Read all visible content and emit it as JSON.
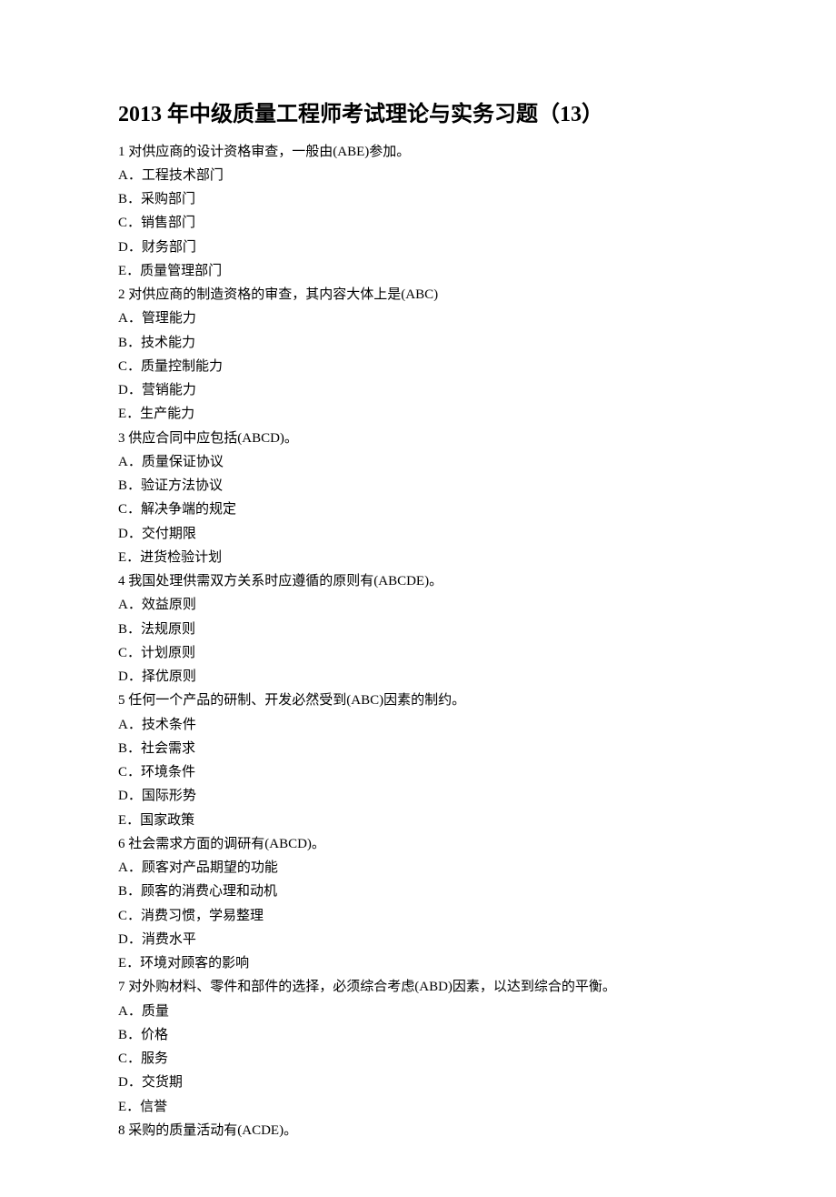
{
  "title": "2013 年中级质量工程师考试理论与实务习题（13）",
  "questions": [
    {
      "stem": "1 对供应商的设计资格审查，一般由(ABE)参加。",
      "options": [
        "A．工程技术部门",
        "B．采购部门",
        "C．销售部门",
        "D．财务部门",
        "E．质量管理部门"
      ]
    },
    {
      "stem": "2 对供应商的制造资格的审查，其内容大体上是(ABC)",
      "options": [
        "A．管理能力",
        "B．技术能力",
        "C．质量控制能力",
        "D．营销能力",
        "E．生产能力"
      ]
    },
    {
      "stem": "3 供应合同中应包括(ABCD)。",
      "options": [
        "A．质量保证协议",
        "B．验证方法协议",
        "C．解决争端的规定",
        "D．交付期限",
        "E．进货检验计划"
      ]
    },
    {
      "stem": "4 我国处理供需双方关系时应遵循的原则有(ABCDE)。",
      "options": [
        "A．效益原则",
        "B．法规原则",
        "C．计划原则",
        "D．择优原则"
      ]
    },
    {
      "stem": "5 任何一个产品的研制、开发必然受到(ABC)因素的制约。",
      "options": [
        "A．技术条件",
        "B．社会需求",
        "C．环境条件",
        "D．国际形势",
        "E．国家政策"
      ]
    },
    {
      "stem": "6 社会需求方面的调研有(ABCD)。",
      "options": [
        "A．顾客对产品期望的功能",
        "B．顾客的消费心理和动机",
        "C．消费习惯，学易整理",
        "D．消费水平",
        "E．环境对顾客的影响"
      ]
    },
    {
      "stem": "7 对外购材料、零件和部件的选择，必须综合考虑(ABD)因素，以达到综合的平衡。",
      "options": [
        "A．质量",
        "B．价格",
        "C．服务",
        "D．交货期",
        "E．信誉"
      ]
    },
    {
      "stem": "8 采购的质量活动有(ACDE)。",
      "options": []
    }
  ]
}
